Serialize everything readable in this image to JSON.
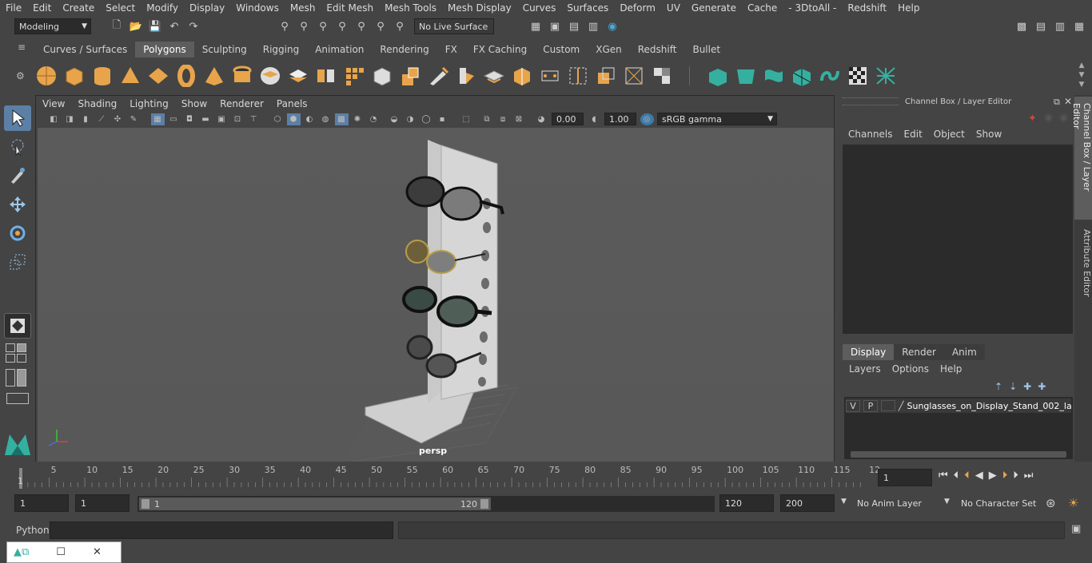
{
  "menubar": [
    "File",
    "Edit",
    "Create",
    "Select",
    "Modify",
    "Display",
    "Windows",
    "Mesh",
    "Edit Mesh",
    "Mesh Tools",
    "Mesh Display",
    "Curves",
    "Surfaces",
    "Deform",
    "UV",
    "Generate",
    "Cache",
    "- 3DtoAll -",
    "Redshift",
    "Help"
  ],
  "status": {
    "mode": "Modeling",
    "live_surface": "No Live Surface"
  },
  "shelf_tabs": [
    "Curves / Surfaces",
    "Polygons",
    "Sculpting",
    "Rigging",
    "Animation",
    "Rendering",
    "FX",
    "FX Caching",
    "Custom",
    "XGen",
    "Redshift",
    "Bullet"
  ],
  "shelf_active": "Polygons",
  "viewport": {
    "menus": [
      "View",
      "Shading",
      "Lighting",
      "Show",
      "Renderer",
      "Panels"
    ],
    "exposure": "0.00",
    "gamma": "1.00",
    "colorspace": "sRGB gamma",
    "camera_label": "persp"
  },
  "channel_box": {
    "title": "Channel Box / Layer Editor",
    "menus": [
      "Channels",
      "Edit",
      "Object",
      "Show"
    ],
    "tabs": [
      "Display",
      "Render",
      "Anim"
    ],
    "active_tab": "Display",
    "layer_menus": [
      "Layers",
      "Options",
      "Help"
    ],
    "layer": {
      "v": "V",
      "p": "P",
      "name": "Sunglasses_on_Display_Stand_002_la"
    }
  },
  "side_tabs": [
    "Channel Box / Layer Editor",
    "Attribute Editor"
  ],
  "timeline": {
    "ticks": [
      "5",
      "10",
      "15",
      "20",
      "25",
      "30",
      "35",
      "40",
      "45",
      "50",
      "55",
      "60",
      "65",
      "70",
      "75",
      "80",
      "85",
      "90",
      "95",
      "100",
      "105",
      "110",
      "115",
      "12"
    ],
    "start_marker": "1",
    "current_frame": "1"
  },
  "range": {
    "start": "1",
    "start2": "1",
    "slider_start": "1",
    "slider_end": "120",
    "end": "120",
    "end2": "200",
    "anim_layer": "No Anim Layer",
    "char_set": "No Character Set"
  },
  "cmd": {
    "label": "Python"
  },
  "colors": {
    "accent_orange": "#e8a44b",
    "accent_teal": "#35b0a0",
    "panel": "#444444",
    "field": "#2b2b2b"
  }
}
